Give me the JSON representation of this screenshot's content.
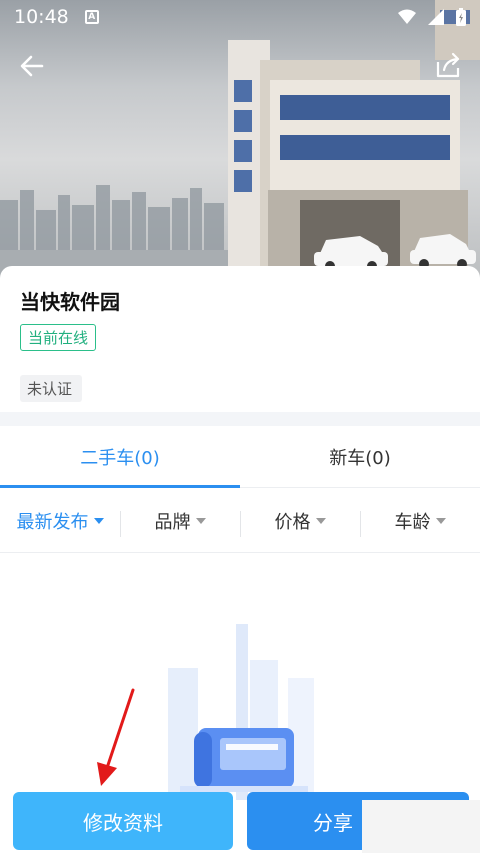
{
  "status_bar": {
    "time": "10:48",
    "notif_badge": "A"
  },
  "header": {
    "back_icon": "back-arrow-icon",
    "share_icon": "share-icon"
  },
  "profile": {
    "name": "当快软件园",
    "online_status": "当前在线",
    "cert_status": "未认证"
  },
  "tabs": [
    {
      "label": "二手车(0)",
      "active": true
    },
    {
      "label": "新车(0)",
      "active": false
    }
  ],
  "filters": [
    {
      "label": "最新发布",
      "active": true
    },
    {
      "label": "品牌",
      "active": false
    },
    {
      "label": "价格",
      "active": false
    },
    {
      "label": "车龄",
      "active": false
    }
  ],
  "actions": {
    "edit_label": "修改资料",
    "share_label": "分享"
  },
  "colors": {
    "accent": "#2b8ff0",
    "online": "#21b07f",
    "edit_button": "#3fb5fb"
  }
}
